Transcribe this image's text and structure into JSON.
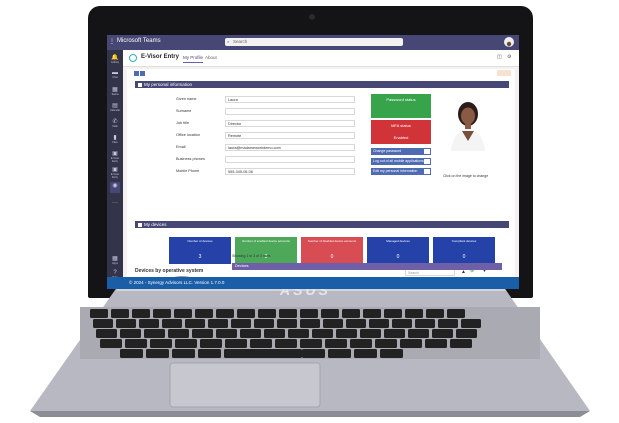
{
  "teams": {
    "app_title": "Microsoft Teams",
    "search_placeholder": "Search",
    "rail": [
      "Activity",
      "Chat",
      "Teams",
      "Calendar",
      "Calls",
      "Files",
      "E-Visor Entry",
      "E-Visor Entry",
      "",
      "Apps",
      "Help",
      ""
    ]
  },
  "app": {
    "name": "E-Visor Entry",
    "tabs": [
      "My Profile",
      "About"
    ],
    "active_tab": "My Profile"
  },
  "personal": {
    "section_title": "My personal information",
    "fields": [
      {
        "label": "Given name",
        "value": "Laura"
      },
      {
        "label": "Surname",
        "value": ""
      },
      {
        "label": "Job title",
        "value": "Director"
      },
      {
        "label": "Office location",
        "value": "Remote"
      },
      {
        "label": "Email",
        "value": "laura@madameworkdemo.com"
      },
      {
        "label": "Business phones",
        "value": ""
      },
      {
        "label": "Mobile Phone",
        "value": "555-345-05-06"
      }
    ],
    "statuses": [
      {
        "label": "Password status",
        "color": "#37a34a"
      },
      {
        "label": "",
        "color": "#37a34a"
      },
      {
        "label": "MFA status",
        "color": "#d13438"
      },
      {
        "label": "Enabled",
        "color": "#d13438"
      }
    ],
    "links": [
      "Change password",
      "Log out of all mobile applications",
      "Edit my personal information"
    ],
    "photo_caption": "Click on the image to change"
  },
  "devices": {
    "section_title": "My devices",
    "cards": [
      {
        "title": "Number of devices",
        "value": "3",
        "color": "#2542a8"
      },
      {
        "title": "Number of enabled device accounts",
        "value": "3",
        "color": "#4ea85a"
      },
      {
        "title": "Number of disabled device accounts",
        "value": "0",
        "color": "#d84c54"
      },
      {
        "title": "Managed devices",
        "value": "0",
        "color": "#2542a8"
      },
      {
        "title": "Compliant devices",
        "value": "0",
        "color": "#2542a8"
      }
    ],
    "chart_title": "Devices by operative system",
    "search_placeholder": "Search",
    "showing": "Showing 1 to 3 of 3 rows",
    "table_header": "Devices"
  },
  "footer": {
    "text": "© 2024 - Synergy Advisors LLC. Version 1.7.0.0"
  },
  "device": {
    "brand": "ASUS"
  }
}
